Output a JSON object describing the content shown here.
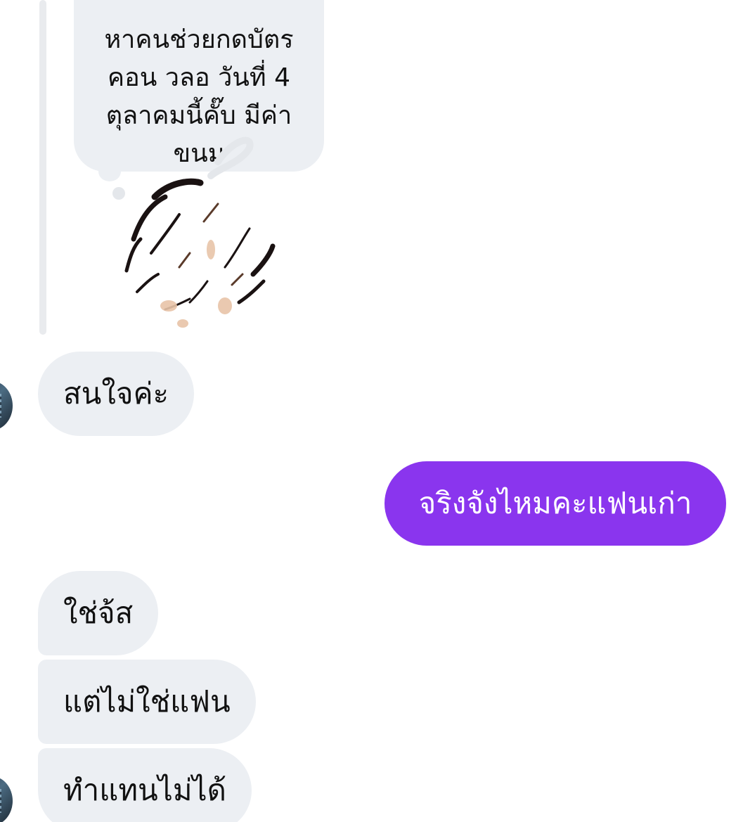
{
  "thread": {
    "quoted_message": "หาคนช่วยกดบัตร\nคอน วลอ วันที่ 4\nตุลาคมนี้คั๊บ มีค่า\nขนม"
  },
  "messages": [
    {
      "direction": "incoming",
      "text": "สนใจค่ะ"
    },
    {
      "direction": "outgoing",
      "text": "จริงจังไหมคะแฟนเก่า"
    },
    {
      "direction": "incoming",
      "text": "ใช่จ้ส"
    },
    {
      "direction": "incoming",
      "text": "แต่ไม่ใช่แฟน"
    },
    {
      "direction": "incoming",
      "text": "ทำแทนไม่ได้"
    }
  ],
  "colors": {
    "incoming_bubble": "#eceff3",
    "outgoing_bubble": "#8a35ee",
    "thread_line": "#e9ebee"
  }
}
